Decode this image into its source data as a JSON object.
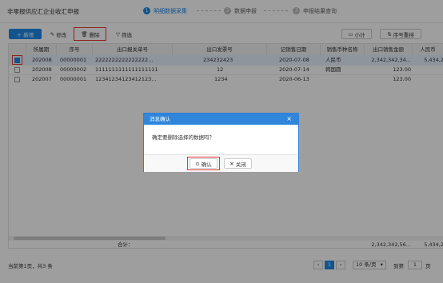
{
  "page": {
    "title": "非零报供应汇企业收汇申报"
  },
  "steps": [
    {
      "num": "1",
      "label": "明细数据采集",
      "active": true
    },
    {
      "num": "2",
      "label": "数据申报",
      "active": false
    },
    {
      "num": "3",
      "label": "申报结果查询",
      "active": false
    }
  ],
  "toolbar": {
    "new": "新增",
    "edit": "修改",
    "delete": "删除",
    "filter": "筛选",
    "subtotal": "小计",
    "sort": "序号重排"
  },
  "table": {
    "columns": [
      "所属期",
      "序号",
      "出口报关单号",
      "出口发票号",
      "记销售日期",
      "销售币种名称",
      "出口销售金额",
      "人民币"
    ],
    "rows": [
      {
        "checked": true,
        "period": "202008",
        "seq": "00000001",
        "customs_no": "2222222222222222...",
        "invoice_no": "234232423",
        "sale_date": "2020-07-08",
        "currency": "人民币",
        "amount": "2,342,342,34...",
        "rmb": "5,434,2"
      },
      {
        "checked": false,
        "period": "202008",
        "seq": "00000002",
        "customs_no": "1111111111111111111",
        "invoice_no": "12",
        "sale_date": "2020-07-14",
        "currency": "韩国圆",
        "amount": "123.00",
        "rmb": ""
      },
      {
        "checked": false,
        "period": "202007",
        "seq": "00000001",
        "customs_no": "12341234123412123...",
        "invoice_no": "1234",
        "sale_date": "2020-06-13",
        "currency": "",
        "amount": "123.00",
        "rmb": ""
      }
    ],
    "total_label": "合计：",
    "total_amount": "2,342,342,56...",
    "total_rmb": "5,434,2"
  },
  "dialog": {
    "title": "消息确认",
    "message": "确定要删除选择的数据吗？",
    "confirm": "确认",
    "close": "关闭"
  },
  "footer": {
    "summary": "当前第1页，共3 条",
    "current_page": "1",
    "page_size": "10 条/页",
    "goto_label": "到第",
    "goto_value": "1",
    "page_unit": "页"
  },
  "colors": {
    "accent": "#1e88e5",
    "highlight": "#e53935"
  }
}
